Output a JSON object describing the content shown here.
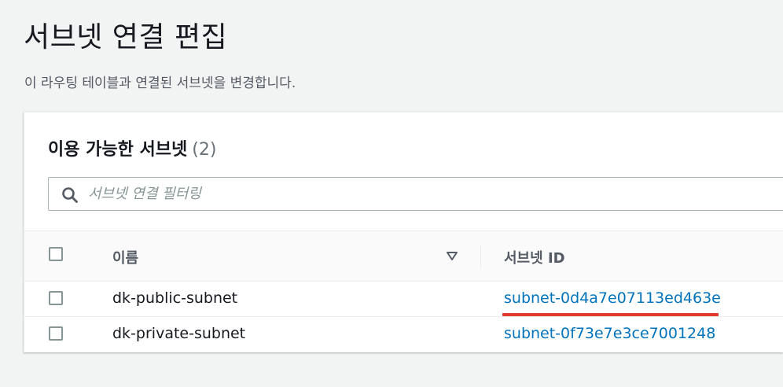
{
  "page": {
    "title": "서브넷 연결 편집",
    "description": "이 라우팅 테이블과 연결된 서브넷을 변경합니다."
  },
  "panel": {
    "header": "이용 가능한 서브넷",
    "count": "(2)"
  },
  "search": {
    "placeholder": "서브넷 연결 필터링",
    "value": ""
  },
  "table": {
    "columns": {
      "name": "이름",
      "subnet_id": "서브넷 ID"
    },
    "rows": [
      {
        "name": "dk-public-subnet",
        "subnet_id": "subnet-0d4a7e07113ed463e",
        "selected": false
      },
      {
        "name": "dk-private-subnet",
        "subnet_id": "subnet-0f73e7e3ce7001248",
        "selected": false
      }
    ]
  },
  "colors": {
    "link": "#0073bb",
    "annotation": "#e3382d",
    "background": "#f2f3f3"
  },
  "icons": {
    "search": "search-icon",
    "sort": "sort-down-icon"
  }
}
